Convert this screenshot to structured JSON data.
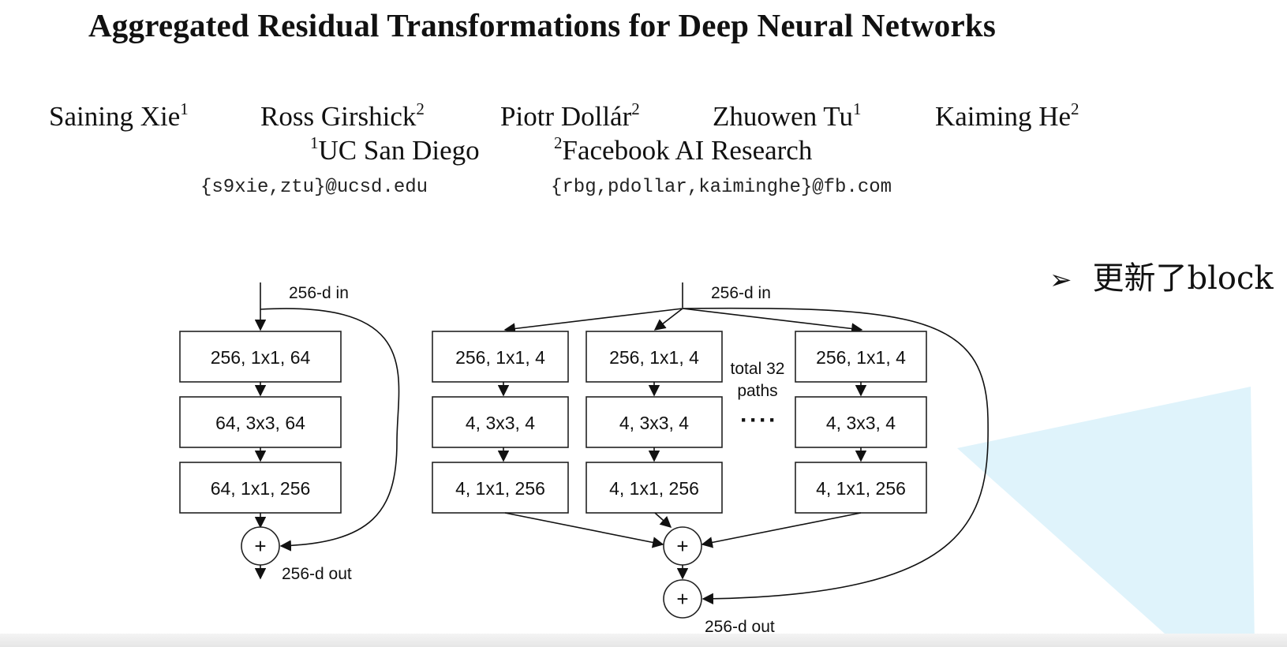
{
  "paper": {
    "title": "Aggregated Residual Transformations for Deep Neural Networks",
    "authors": [
      {
        "name": "Saining Xie",
        "sup": "1"
      },
      {
        "name": "Ross Girshick",
        "sup": "2"
      },
      {
        "name": "Piotr Dollár",
        "sup": "2"
      },
      {
        "name": "Zhuowen Tu",
        "sup": "1"
      },
      {
        "name": "Kaiming He",
        "sup": "2"
      }
    ],
    "affiliations": [
      {
        "sup": "1",
        "name": "UC San Diego"
      },
      {
        "sup": "2",
        "name": "Facebook AI Research"
      }
    ],
    "emails": [
      "{s9xie,ztu}@ucsd.edu",
      "{rbg,pdollar,kaiminghe}@fb.com"
    ]
  },
  "note": {
    "marker": "➢",
    "text": "更新了block"
  },
  "figure": {
    "left_block": {
      "input_label": "256-d in",
      "layers": [
        "256, 1x1, 64",
        "64, 3x3, 64",
        "64, 1x1, 256"
      ],
      "plus": "+",
      "output_label": "256-d out"
    },
    "right_block": {
      "input_label": "256-d in",
      "paths": [
        [
          "256, 1x1, 4",
          "4, 3x3, 4",
          "4, 1x1, 256"
        ],
        [
          "256, 1x1, 4",
          "4, 3x3, 4",
          "4, 1x1, 256"
        ],
        [
          "256, 1x1, 4",
          "4, 3x3, 4",
          "4, 1x1, 256"
        ]
      ],
      "paths_note_line1": "total 32",
      "paths_note_line2": "paths",
      "ellipsis": "····",
      "plus1": "+",
      "plus2": "+",
      "output_label": "256-d out"
    }
  },
  "colors": {
    "accent_triangle": "#dff3fb"
  }
}
